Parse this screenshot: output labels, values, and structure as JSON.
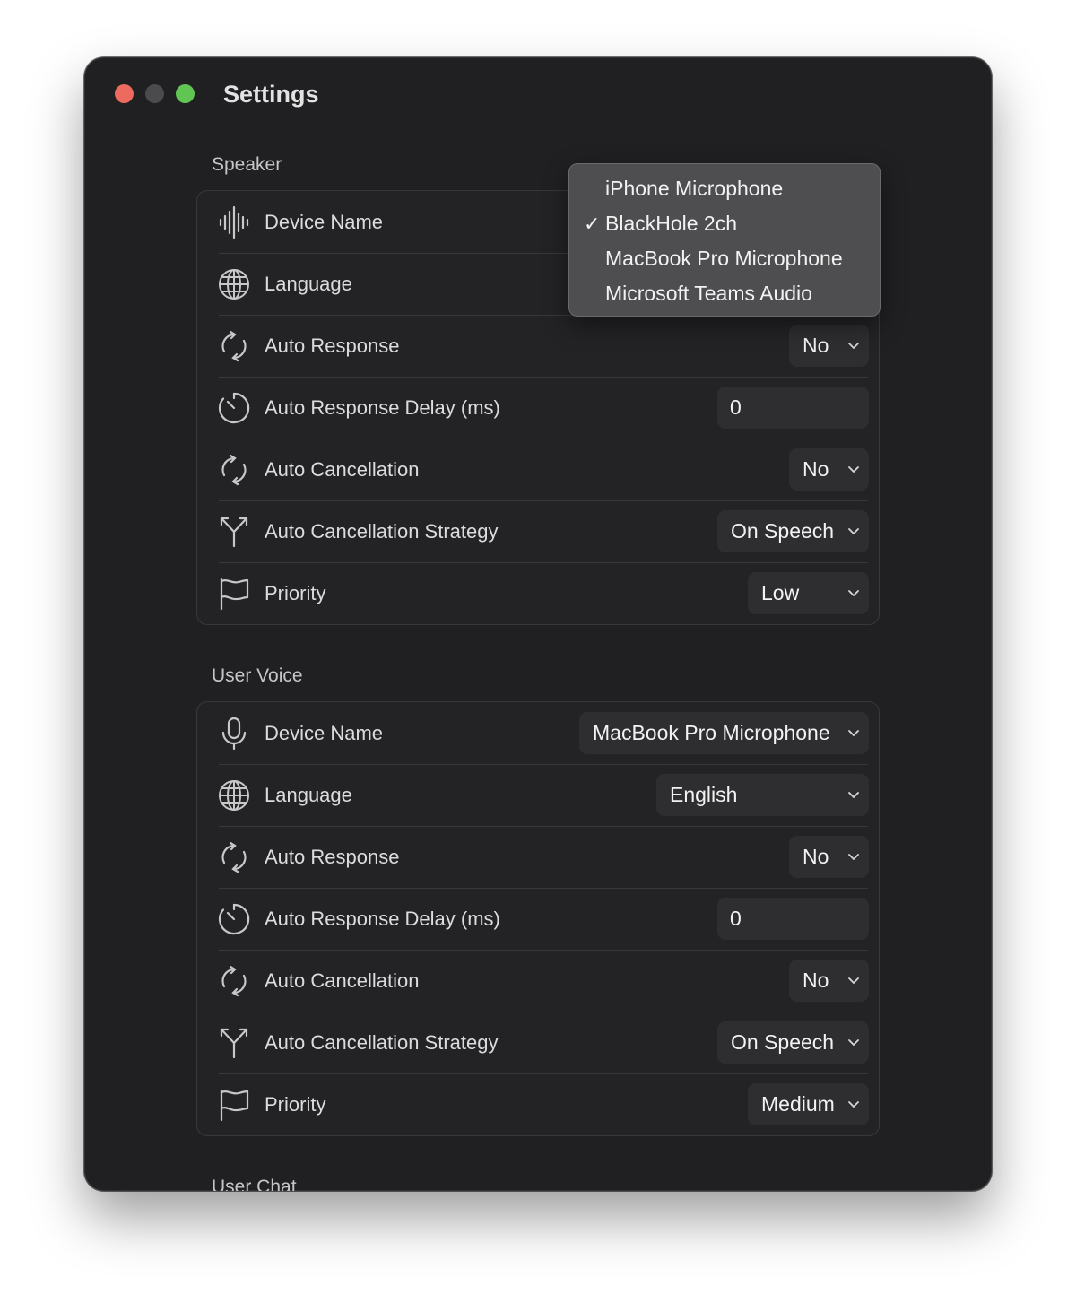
{
  "window": {
    "title": "Settings"
  },
  "sections": [
    {
      "label": "Speaker",
      "rows": [
        {
          "icon": "waveform-icon",
          "label": "Device Name",
          "control": "none",
          "value": ""
        },
        {
          "icon": "globe-icon",
          "label": "Language",
          "control": "none",
          "value": ""
        },
        {
          "icon": "refresh-icon",
          "label": "Auto Response",
          "control": "select",
          "value": "No"
        },
        {
          "icon": "timer-icon",
          "label": "Auto Response Delay (ms)",
          "control": "input",
          "value": "0"
        },
        {
          "icon": "refresh-icon",
          "label": "Auto Cancellation",
          "control": "select",
          "value": "No"
        },
        {
          "icon": "split-arrow-icon",
          "label": "Auto Cancellation Strategy",
          "control": "select",
          "value": "On Speech"
        },
        {
          "icon": "flag-icon",
          "label": "Priority",
          "control": "select",
          "value": "Low"
        }
      ]
    },
    {
      "label": "User Voice",
      "rows": [
        {
          "icon": "microphone-icon",
          "label": "Device Name",
          "control": "select",
          "value": "MacBook Pro Microphone"
        },
        {
          "icon": "globe-icon",
          "label": "Language",
          "control": "select",
          "value": "English"
        },
        {
          "icon": "refresh-icon",
          "label": "Auto Response",
          "control": "select",
          "value": "No"
        },
        {
          "icon": "timer-icon",
          "label": "Auto Response Delay (ms)",
          "control": "input",
          "value": "0"
        },
        {
          "icon": "refresh-icon",
          "label": "Auto Cancellation",
          "control": "select",
          "value": "No"
        },
        {
          "icon": "split-arrow-icon",
          "label": "Auto Cancellation Strategy",
          "control": "select",
          "value": "On Speech"
        },
        {
          "icon": "flag-icon",
          "label": "Priority",
          "control": "select",
          "value": "Medium"
        }
      ]
    },
    {
      "label": "User Chat",
      "rows": []
    }
  ],
  "dropdown": {
    "items": [
      "iPhone Microphone",
      "BlackHole 2ch",
      "MacBook Pro Microphone",
      "Microsoft Teams Audio"
    ],
    "selected_index": 1,
    "check_glyph": "✓"
  },
  "colors": {
    "window_bg": "#202023",
    "group_bg": "#232326",
    "control_bg": "#2e2e31",
    "popup_bg": "#4e4e51",
    "close": "#ec6a5e",
    "minimize": "#4b4b4e",
    "zoom": "#61c554"
  }
}
